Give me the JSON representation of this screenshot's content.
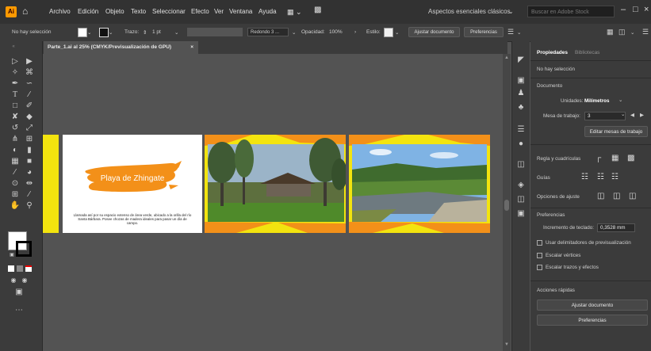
{
  "app": {
    "logo_text": "Ai"
  },
  "menu": [
    "Archivo",
    "Edición",
    "Objeto",
    "Texto",
    "Seleccionar",
    "Efecto",
    "Ver",
    "Ventana",
    "Ayuda"
  ],
  "workspace": "Aspectos esenciales clásicos",
  "search_placeholder": "Buscar en Adobe Stock",
  "control": {
    "selection": "No hay selección",
    "stroke_label": "Trazo:",
    "stroke_value": "1 pt",
    "brush": "Redondo 3 ...",
    "opacity_label": "Opacidad:",
    "opacity_value": "100%",
    "style_label": "Estilo:",
    "fit_button": "Ajustar documento",
    "prefs_button": "Preferencias"
  },
  "document_tab": "Parte_1.ai al 25% (CMYK/Previsualización de GPU)",
  "artboard1": {
    "title": "Playa de Zhingate",
    "body": "Llamada así por su espacio extenso de área verde, ubicado a la orilla del río Santa Bárbara. Posee chozas de madera ideales para pasar un día de campo."
  },
  "panel": {
    "tab_properties": "Propiedades",
    "tab_libraries": "Bibliotecas",
    "no_selection": "No hay selección",
    "document_heading": "Documento",
    "units_label": "Unidades:",
    "units_value": "Milímetros",
    "artboard_label": "Mesa de trabajo:",
    "artboard_value": "3",
    "edit_artboards_button": "Editar mesas de trabajo",
    "rulers_label": "Regla y cuadrículas",
    "guides_label": "Guías",
    "snap_label": "Opciones de ajuste",
    "prefs_heading": "Preferencias",
    "keyboard_inc_label": "Incremento de teclado:",
    "keyboard_inc_value": "0,3528 mm",
    "chk_preview_bounds": "Usar delimitadores de previsualización",
    "chk_scale_corners": "Escalar vértices",
    "chk_scale_strokes": "Escalar trazos y efectos",
    "quick_actions_heading": "Acciones rápidas",
    "fit_document_button": "Ajustar documento",
    "preferences_button": "Preferencias"
  },
  "colors": {
    "orange": "#f39019",
    "yellow": "#f3e40f",
    "ui_dark": "#3b3b3b"
  }
}
